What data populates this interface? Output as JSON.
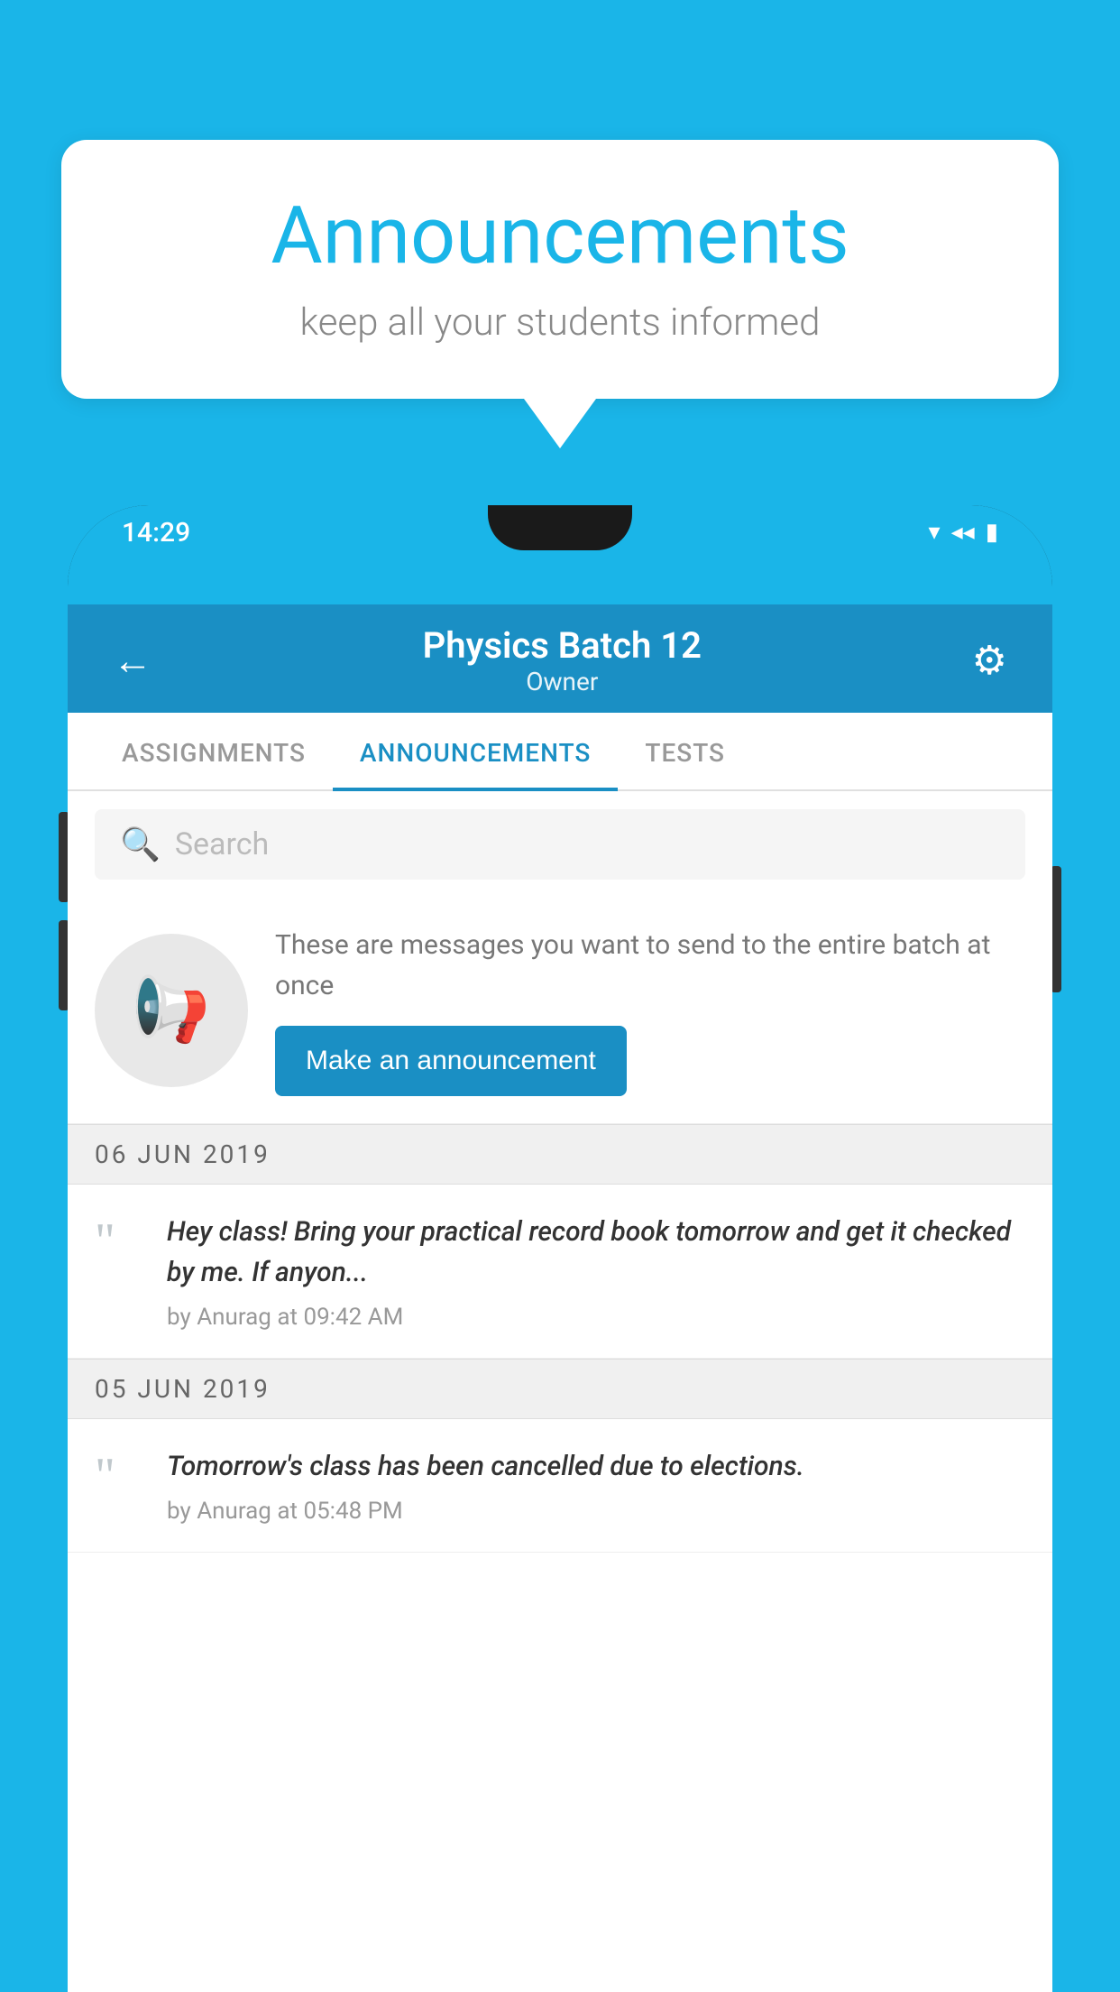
{
  "bubble": {
    "title": "Announcements",
    "subtitle": "keep all your students informed"
  },
  "status_bar": {
    "time": "14:29",
    "wifi_icon": "▾",
    "signal_icon": "◂",
    "battery_icon": "▮"
  },
  "header": {
    "title": "Physics Batch 12",
    "subtitle": "Owner",
    "back_label": "←",
    "settings_label": "⚙"
  },
  "tabs": [
    {
      "label": "ASSIGNMENTS",
      "active": false
    },
    {
      "label": "ANNOUNCEMENTS",
      "active": true
    },
    {
      "label": "TESTS",
      "active": false
    }
  ],
  "search": {
    "placeholder": "Search"
  },
  "cta": {
    "description": "These are messages you want to send to the entire batch at once",
    "button_label": "Make an announcement"
  },
  "announcements": [
    {
      "date": "06  JUN  2019",
      "text": "Hey class! Bring your practical record book tomorrow and get it checked by me. If anyon...",
      "meta": "by Anurag at 09:42 AM"
    },
    {
      "date": "05  JUN  2019",
      "text": "Tomorrow's class has been cancelled due to elections.",
      "meta": "by Anurag at 05:48 PM"
    }
  ],
  "colors": {
    "background": "#1ab5e8",
    "app_header": "#1a8fc4",
    "button": "#1a8fc4"
  }
}
